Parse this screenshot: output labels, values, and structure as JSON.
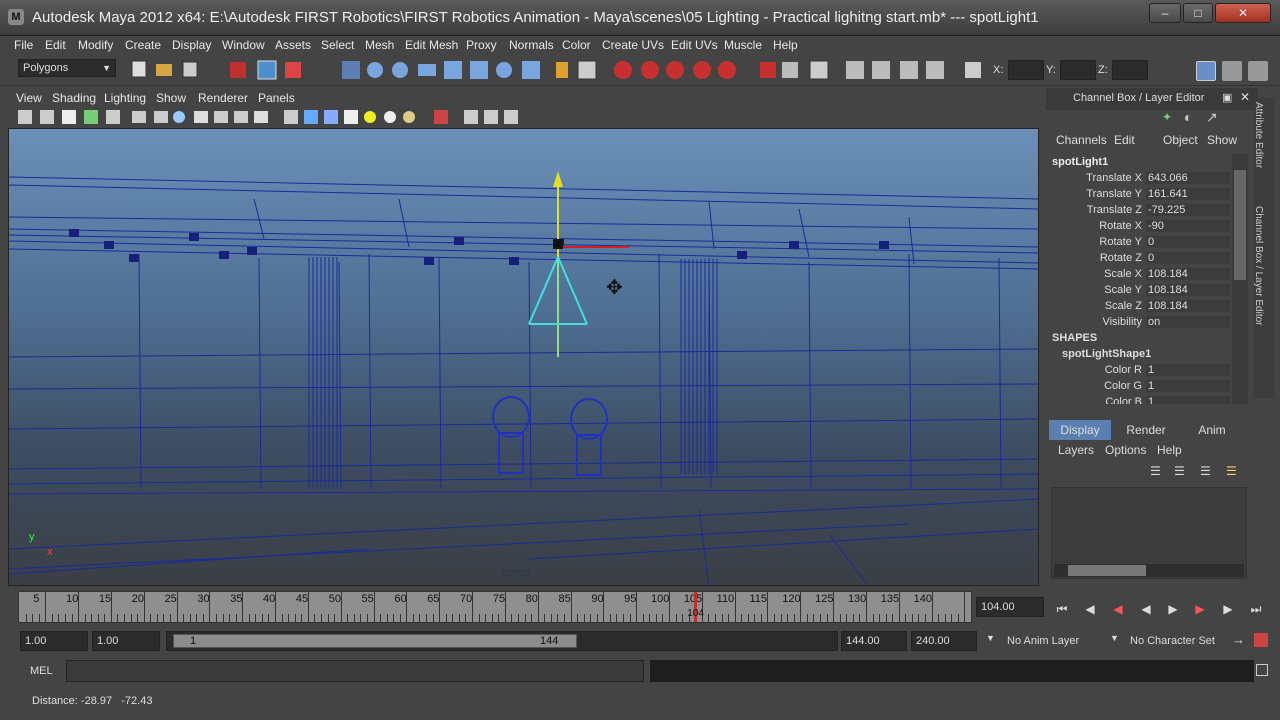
{
  "window": {
    "title": "Autodesk Maya 2012 x64: E:\\Autodesk FIRST Robotics\\FIRST Robotics Animation - Maya\\scenes\\05 Lighting - Practical lighitng start.mb*   ---   spotLight1",
    "logo_letter": "M"
  },
  "menubar": [
    "File",
    "Edit",
    "Modify",
    "Create",
    "Display",
    "Window",
    "Assets",
    "Select",
    "Mesh",
    "Edit Mesh",
    "Proxy",
    "Normals",
    "Color",
    "Create UVs",
    "Edit UVs",
    "Muscle",
    "Help"
  ],
  "shelf": {
    "mode": "Polygons",
    "x_label": "X:",
    "y_label": "Y:",
    "z_label": "Z:",
    "x_value": "",
    "y_value": "",
    "z_value": ""
  },
  "panel_menu": [
    "View",
    "Shading",
    "Lighting",
    "Show",
    "Renderer",
    "Panels"
  ],
  "viewport": {
    "axis_y": "y",
    "axis_x": "x",
    "camera_label": "persp"
  },
  "channel_box": {
    "header": "Channel Box / Layer Editor",
    "menus": [
      "Channels",
      "Edit",
      "Object",
      "Show"
    ],
    "node": "spotLight1",
    "attrs": [
      {
        "label": "Translate X",
        "value": "643.066"
      },
      {
        "label": "Translate Y",
        "value": "161.641"
      },
      {
        "label": "Translate Z",
        "value": "-79.225"
      },
      {
        "label": "Rotate X",
        "value": "-90"
      },
      {
        "label": "Rotate Y",
        "value": "0"
      },
      {
        "label": "Rotate Z",
        "value": "0"
      },
      {
        "label": "Scale X",
        "value": "108.184"
      },
      {
        "label": "Scale Y",
        "value": "108.184"
      },
      {
        "label": "Scale Z",
        "value": "108.184"
      },
      {
        "label": "Visibility",
        "value": "on"
      }
    ],
    "shapes_label": "SHAPES",
    "shape_node": "spotLightShape1",
    "shape_attrs": [
      {
        "label": "Color R",
        "value": "1"
      },
      {
        "label": "Color G",
        "value": "1"
      },
      {
        "label": "Color B",
        "value": "1"
      }
    ],
    "side_tabs": [
      "Attribute Editor",
      "Channel Box / Layer Editor"
    ]
  },
  "layer_editor": {
    "tabs": [
      "Display",
      "Render",
      "Anim"
    ],
    "menus": [
      "Layers",
      "Options",
      "Help"
    ]
  },
  "timeline": {
    "ticks": [
      "5",
      "10",
      "15",
      "20",
      "25",
      "30",
      "35",
      "40",
      "45",
      "50",
      "55",
      "60",
      "65",
      "70",
      "75",
      "80",
      "85",
      "90",
      "95",
      "100",
      "105",
      "110",
      "115",
      "120",
      "125",
      "130",
      "135",
      "140"
    ],
    "current": "104",
    "current_field": "104.00"
  },
  "range": {
    "start_outer": "1.00",
    "start_inner": "1.00",
    "slider_start": "1",
    "slider_end": "144",
    "end_inner": "144.00",
    "end_outer": "240.00",
    "anim_layer": "No Anim Layer",
    "character_set": "No Character Set"
  },
  "command": {
    "mel_label": "MEL",
    "value": ""
  },
  "help_line": "Distance: -28.97   -72.43",
  "colors": {
    "accent_tab": "#5a7fb0",
    "time_marker": "#c03030",
    "wire": "#1a2a9a",
    "light": "#40e0e0"
  }
}
